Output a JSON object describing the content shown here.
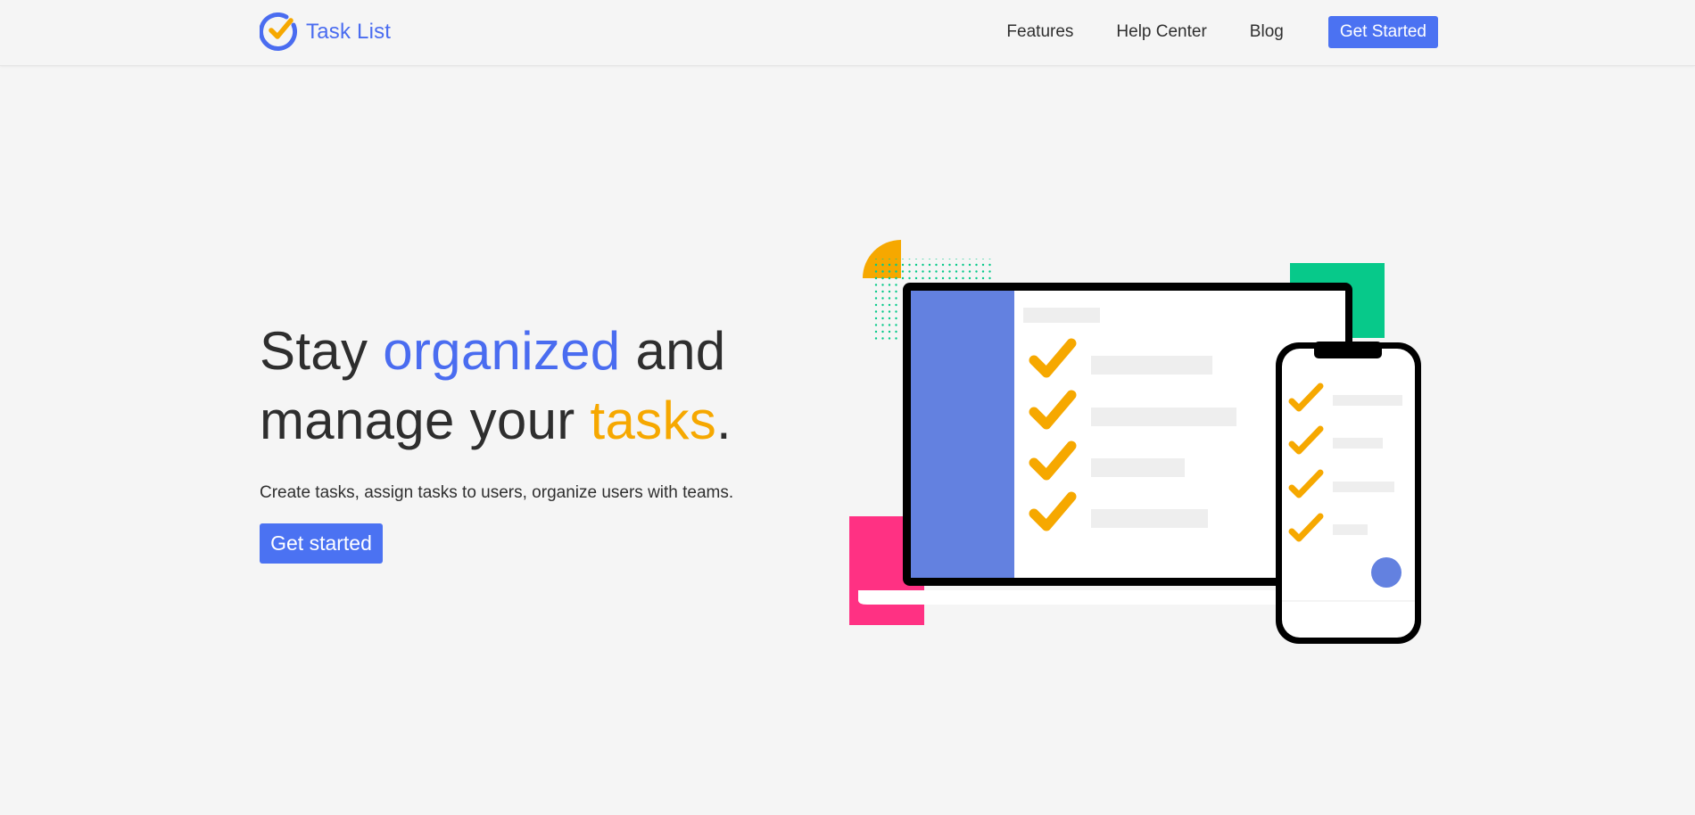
{
  "brand": {
    "name": "Task List",
    "logo_icon": "check-circle-icon",
    "colors": {
      "ring": "#4a6cf0",
      "check": "#f6a800"
    }
  },
  "nav": {
    "links": [
      "Features",
      "Help Center",
      "Blog"
    ],
    "cta_label": "Get Started"
  },
  "hero": {
    "headline": {
      "part1": "Stay ",
      "highlight1": "organized",
      "part2": " and manage your ",
      "highlight2": "tasks",
      "part3": "."
    },
    "subtitle": "Create tasks, assign tasks to users, organize users with teams.",
    "cta_label": "Get started"
  },
  "illustration": {
    "checkmark_icon": "checkmark-icon",
    "colors": {
      "sidebar": "#6381e0",
      "check": "#f6a800",
      "green": "#07c98a",
      "pink": "#ff3183",
      "placeholder": "#eeeeee",
      "frame": "#000000"
    }
  },
  "theme": {
    "background": "#f5f5f5",
    "primary": "#4b72f2",
    "text": "#2e2e2e"
  }
}
